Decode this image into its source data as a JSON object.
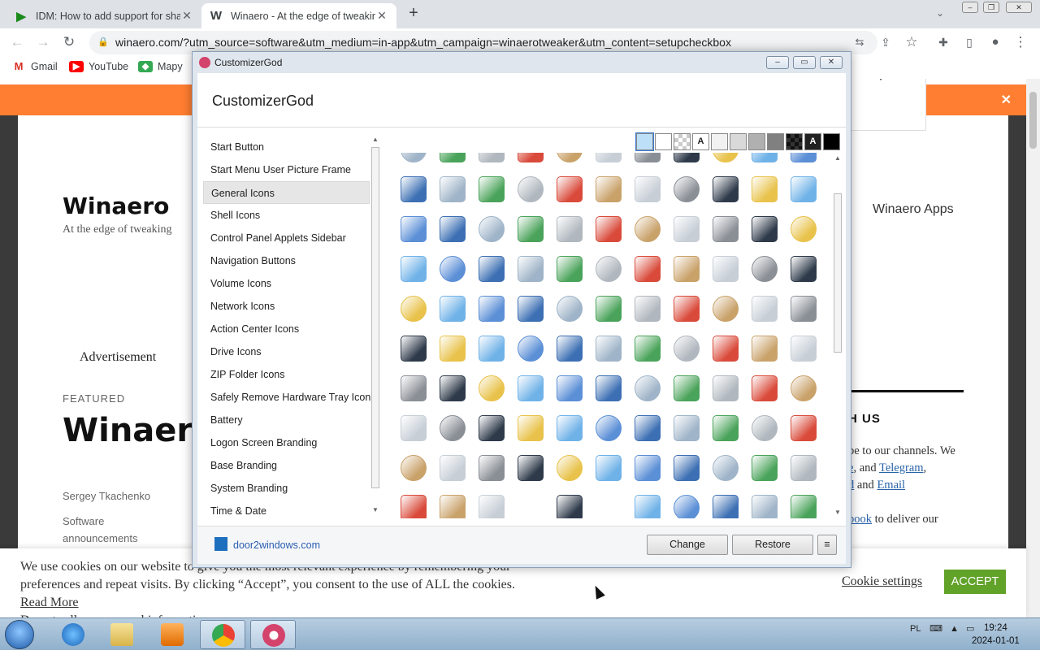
{
  "browser": {
    "tabs": [
      {
        "title": "IDM: How to add support for sha",
        "active": false
      },
      {
        "title": "Winaero - At the edge of tweakin",
        "active": true
      }
    ],
    "url": "winaero.com/?utm_source=software&utm_medium=in-app&utm_campaign=winaerotweaker&utm_content=setupcheckbox",
    "bookmarks": [
      "Gmail",
      "YouTube",
      "Mapy"
    ]
  },
  "page": {
    "site_name": "Winaero",
    "tagline": "At the edge of tweaking",
    "apps_link": "Winaero Apps",
    "advertisement": "Advertisement",
    "featured": "FEATURED",
    "featured_title": "Winaero",
    "author": "Sergey Tkachenko",
    "category": "Software announcements",
    "follow_us": "H US",
    "side_text_1": "be to our channels. We",
    "side_link_e": "e",
    "side_text_and1": ", and ",
    "side_link_telegram": "Telegram",
    "side_text_comma": ",",
    "side_link_d": "d",
    "side_text_and2": " and ",
    "side_link_email": "Email",
    "side_link_book": "book",
    "side_text_2": " to deliver our"
  },
  "cookie": {
    "text": "We use cookies on our website to give you the most relevant experience by remembering your preferences and repeat visits. By clicking “Accept”, you consent to the use of ALL the cookies.",
    "read_more": "Read More",
    "do_not_sell": "Do not sell my personal information",
    "settings": "Cookie settings",
    "accept": "ACCEPT"
  },
  "app": {
    "window_title": "CustomizerGod",
    "heading": "CustomizerGod",
    "categories": [
      "Start Button",
      "Start Menu User Picture Frame",
      "General Icons",
      "Shell Icons",
      "Control Panel Applets Sidebar",
      "Navigation Buttons",
      "Volume Icons",
      "Network Icons",
      "Action Center Icons",
      "Drive Icons",
      "ZIP Folder Icons",
      "Safely Remove Hardware Tray Icon",
      "Battery",
      "Logon Screen Branding",
      "Base Branding",
      "System Branding",
      "Time & Date"
    ],
    "selected_category": "General Icons",
    "swatches": [
      "#bde0f8",
      "#ffffff",
      "checker",
      "A",
      "#f2f2f2",
      "#d9d9d9",
      "#b0b0b0",
      "#808080",
      "dark-checker",
      "A",
      "#000000"
    ],
    "footer_link": "door2windows.com",
    "change_label": "Change",
    "restore_label": "Restore",
    "menu_label": "≡"
  },
  "taskbar": {
    "lang": "PL",
    "time": "19:24",
    "date": "2024-01-01"
  }
}
